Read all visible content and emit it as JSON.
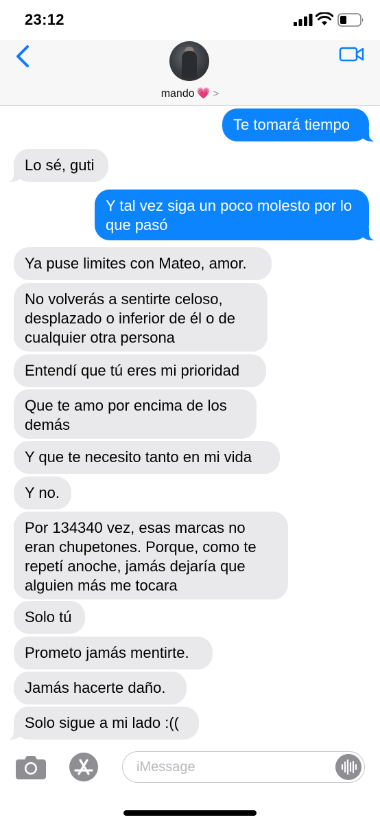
{
  "status_bar": {
    "time": "23:12"
  },
  "header": {
    "contact_name": "mando",
    "contact_emoji": "💗",
    "chevron": ">"
  },
  "messages": [
    {
      "from": "me",
      "text": "Te tomará tiempo"
    },
    {
      "from": "them",
      "text": "Lo sé, guti"
    },
    {
      "from": "me",
      "text": "Y tal vez siga un poco molesto por lo que pasó"
    },
    {
      "from": "them",
      "text": "Ya puse limites con Mateo, amor."
    },
    {
      "from": "them",
      "text": "No volverás a sentirte celoso, desplazado o inferior de él o de cualquier otra persona"
    },
    {
      "from": "them",
      "text": "Entendí que tú eres mi prioridad"
    },
    {
      "from": "them",
      "text": "Que te amo por encima de los demás"
    },
    {
      "from": "them",
      "text": "Y que te necesito tanto en mi vida"
    },
    {
      "from": "them",
      "text": "Y no."
    },
    {
      "from": "them",
      "text": "Por 134340 vez, esas marcas no eran chupetones. Porque, como te repetí anoche, jamás dejaría que alguien más me tocara"
    },
    {
      "from": "them",
      "text": "Solo tú"
    },
    {
      "from": "them",
      "text": "Prometo jamás mentirte."
    },
    {
      "from": "them",
      "text": "Jamás hacerte daño."
    },
    {
      "from": "them",
      "text": "Solo sigue a mi lado :(("
    }
  ],
  "input": {
    "placeholder": "iMessage"
  },
  "colors": {
    "sent_bubble": "#0b84fe",
    "received_bubble": "#e9e9eb",
    "accent": "#0a7cff"
  },
  "icons": [
    "signal-icon",
    "wifi-icon",
    "battery-icon",
    "back-chevron-icon",
    "video-camera-icon",
    "camera-icon",
    "app-store-icon",
    "audio-waveform-icon"
  ]
}
